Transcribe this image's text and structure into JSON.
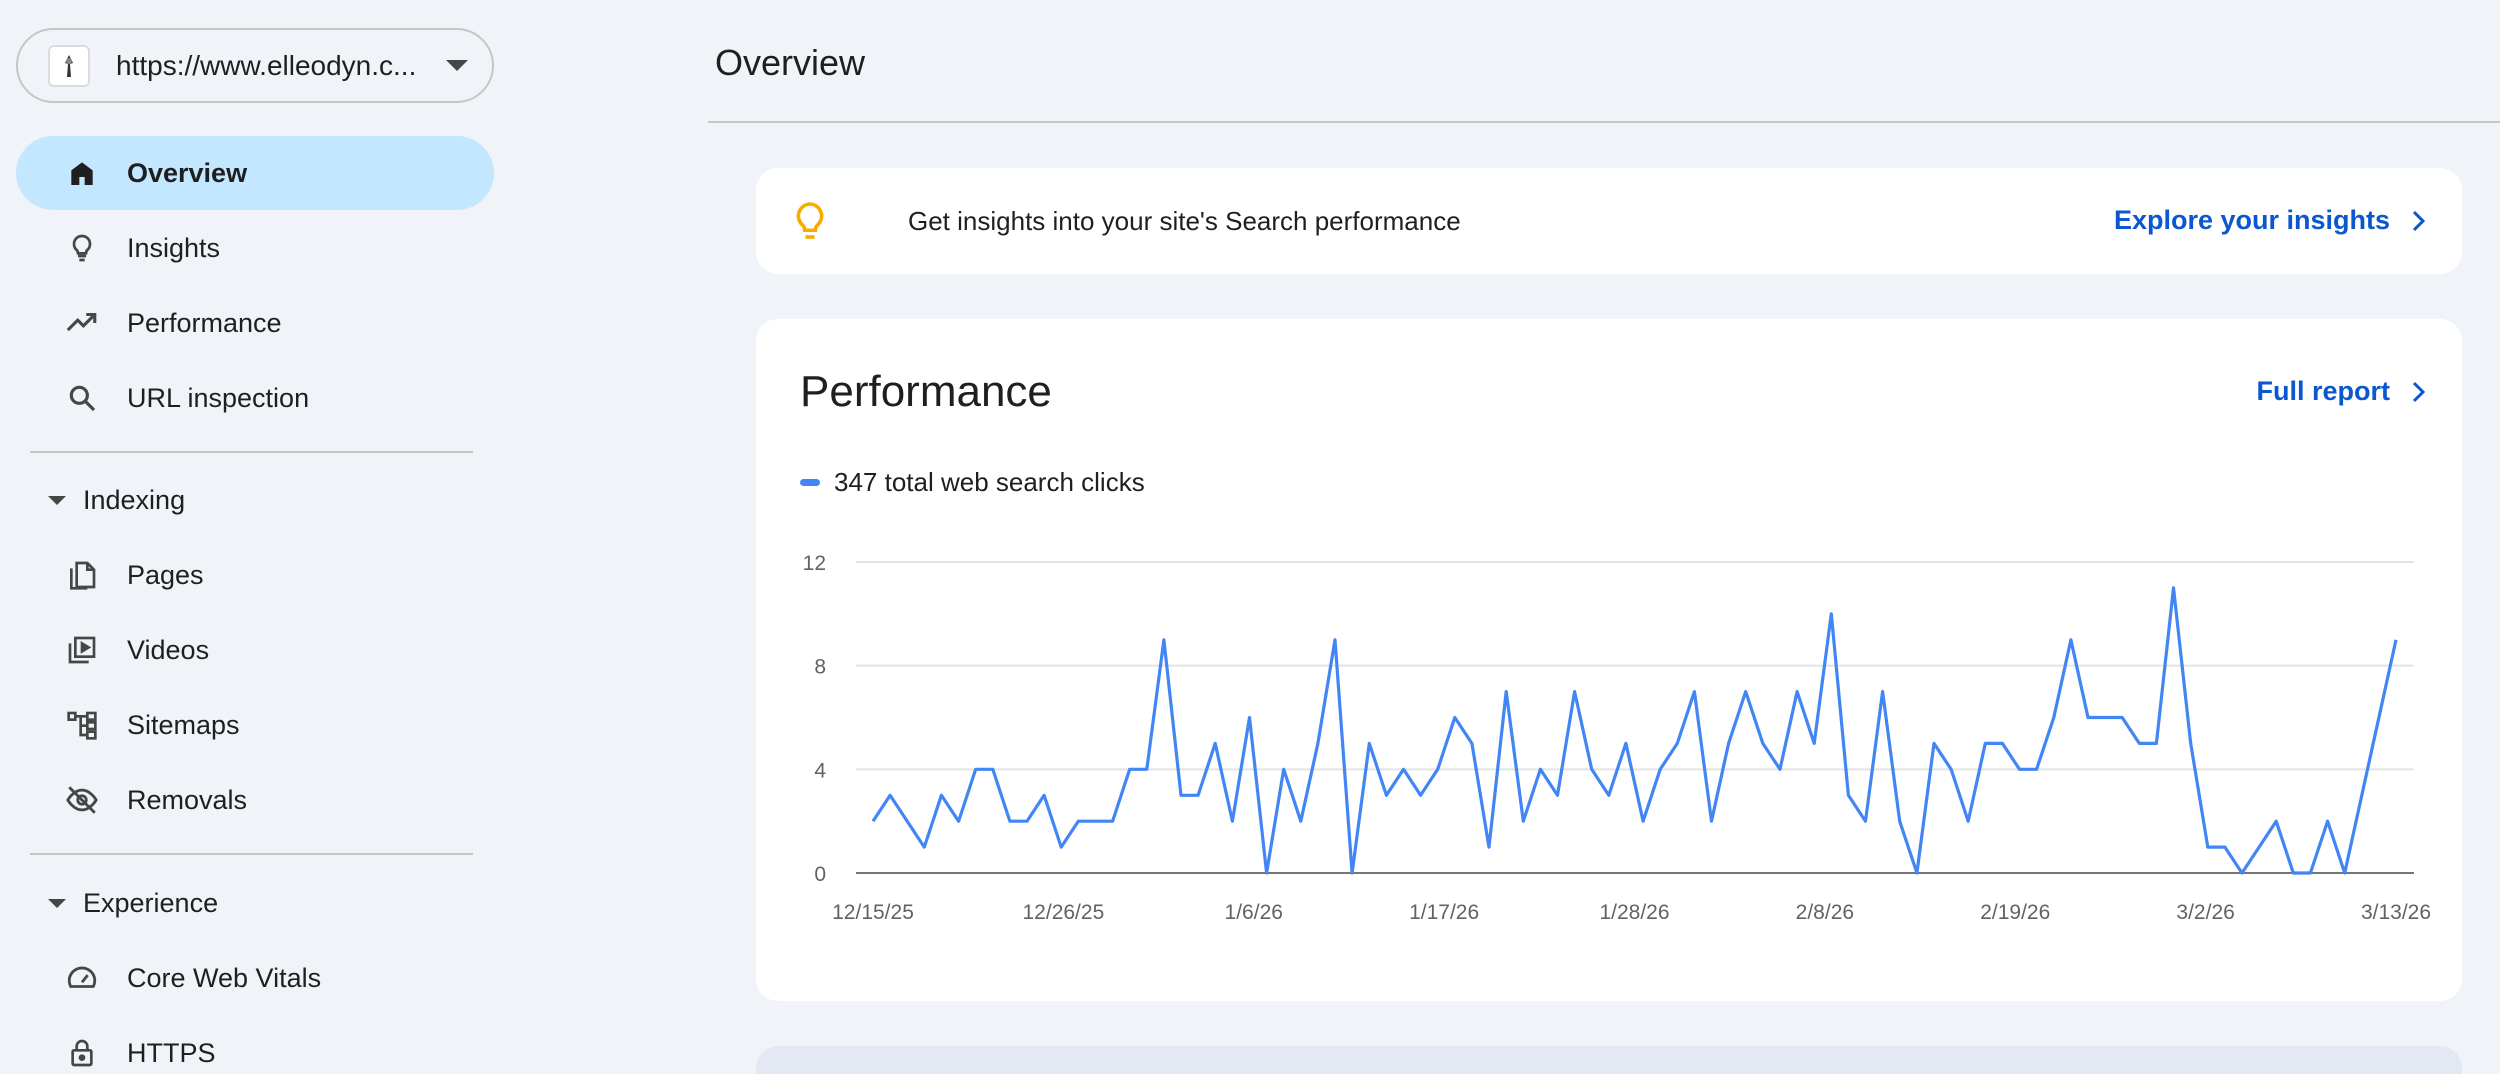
{
  "property": {
    "url": "https://www.elleodyn.c..."
  },
  "nav": {
    "overview": "Overview",
    "insights": "Insights",
    "performance": "Performance",
    "url_inspection": "URL inspection",
    "indexing": "Indexing",
    "pages": "Pages",
    "videos": "Videos",
    "sitemaps": "Sitemaps",
    "removals": "Removals",
    "experience": "Experience",
    "core_web_vitals": "Core Web Vitals",
    "https": "HTTPS"
  },
  "main": {
    "title": "Overview",
    "insights_text": "Get insights into your site's Search performance",
    "insights_link": "Explore your insights",
    "performance_title": "Performance",
    "full_report": "Full report",
    "legend": "347 total web search clicks"
  },
  "colors": {
    "accent": "#0b57d0",
    "active_nav": "#c2e7ff",
    "series": "#4285f4",
    "bulb": "#f9ab00"
  },
  "chart_data": {
    "type": "line",
    "ylim": [
      0,
      12
    ],
    "yticks": [
      0,
      4,
      8,
      12
    ],
    "xtick_labels": [
      "12/15/25",
      "12/26/25",
      "1/6/26",
      "1/17/26",
      "1/28/26",
      "2/8/26",
      "2/19/26",
      "3/2/26",
      "3/13/26"
    ],
    "x_start": "12/15/25",
    "x_end": "3/13/26",
    "series": [
      {
        "name": "347 total web search clicks",
        "values": [
          2,
          3,
          2,
          1,
          3,
          2,
          4,
          4,
          2,
          2,
          3,
          1,
          2,
          2,
          2,
          4,
          4,
          9,
          3,
          3,
          5,
          2,
          6,
          0,
          4,
          2,
          5,
          9,
          0,
          5,
          3,
          4,
          3,
          4,
          6,
          5,
          1,
          7,
          2,
          4,
          3,
          7,
          4,
          3,
          5,
          2,
          4,
          5,
          7,
          2,
          5,
          7,
          5,
          4,
          7,
          5,
          10,
          3,
          2,
          7,
          2,
          0,
          5,
          4,
          2,
          5,
          5,
          4,
          4,
          6,
          9,
          6,
          6,
          6,
          5,
          5,
          11,
          5,
          1,
          1,
          0,
          1,
          2,
          0,
          0,
          2,
          0,
          3,
          6,
          9
        ]
      }
    ]
  }
}
